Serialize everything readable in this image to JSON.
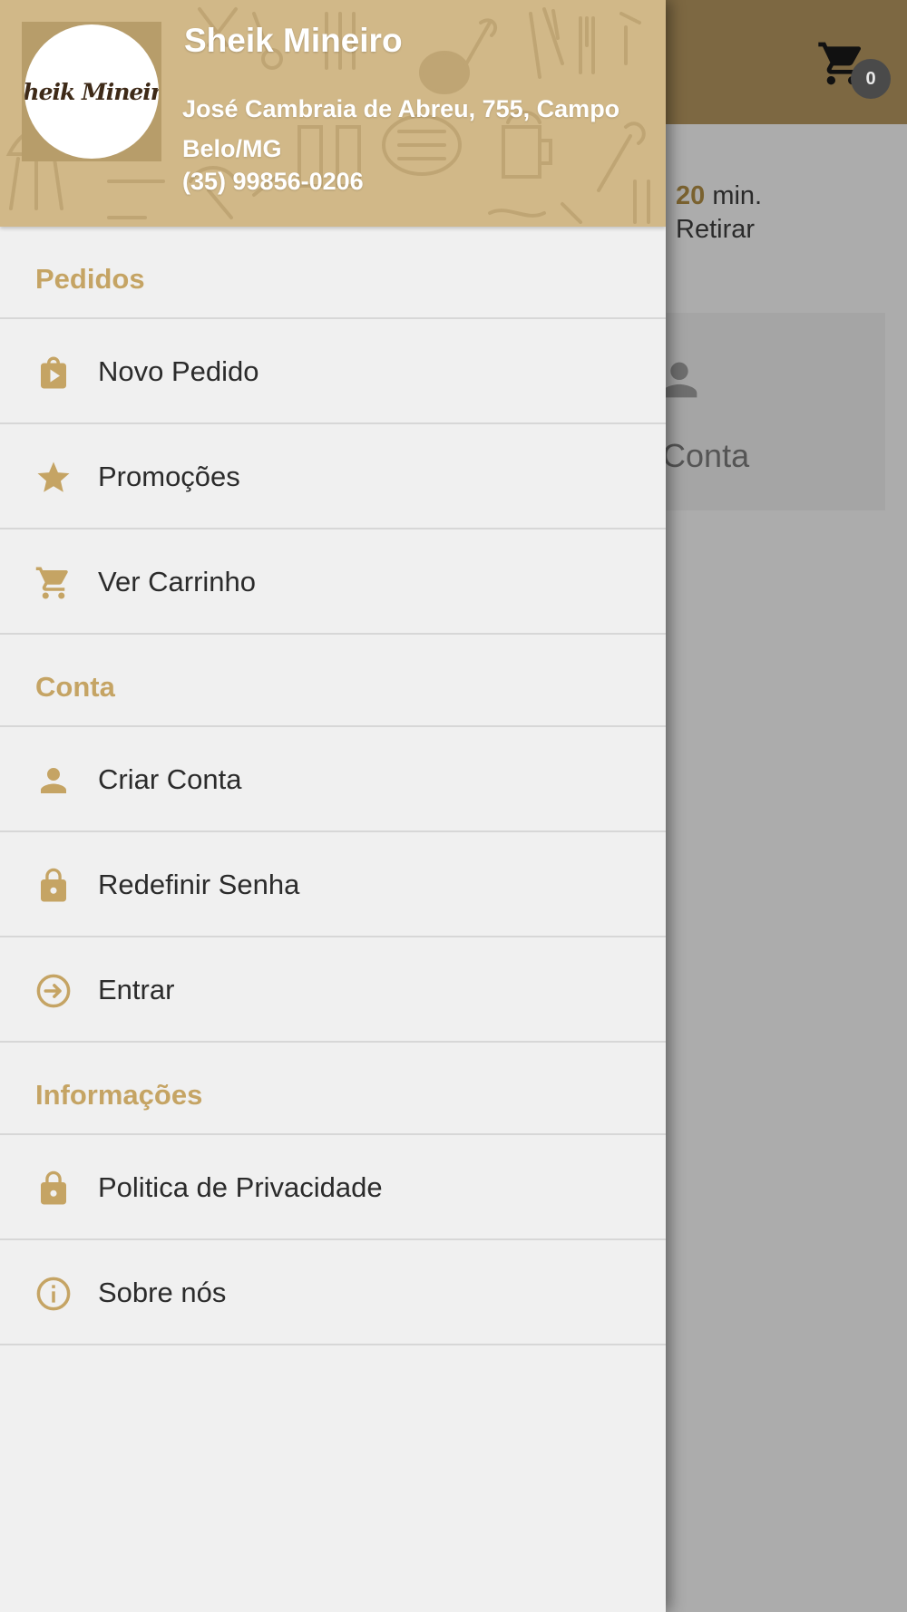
{
  "app_bar": {
    "cart_count": "0",
    "cart_icon": "cart-icon"
  },
  "background": {
    "eta_value": "20",
    "eta_unit": "min.",
    "pickup_label": "Retirar",
    "card_label": "a Conta",
    "card_icon": "person-icon"
  },
  "drawer": {
    "header": {
      "logo_text": "Sheik Mineiro",
      "store_name": "Sheik Mineiro",
      "address": "José Cambraia de Abreu, 755, Campo Belo/MG",
      "phone": "(35) 99856-0206"
    },
    "sections": [
      {
        "title": "Pedidos",
        "items": [
          {
            "label": "Novo Pedido",
            "icon": "shopping-bag-icon"
          },
          {
            "label": "Promoções",
            "icon": "star-icon"
          },
          {
            "label": "Ver Carrinho",
            "icon": "cart-icon"
          }
        ]
      },
      {
        "title": "Conta",
        "items": [
          {
            "label": "Criar Conta",
            "icon": "person-icon"
          },
          {
            "label": "Redefinir Senha",
            "icon": "lock-icon"
          },
          {
            "label": "Entrar",
            "icon": "login-icon"
          }
        ]
      },
      {
        "title": "Informações",
        "items": [
          {
            "label": "Politica de Privacidade",
            "icon": "lock-icon"
          },
          {
            "label": "Sobre nós",
            "icon": "info-icon"
          }
        ]
      }
    ]
  },
  "colors": {
    "accent": "#c5a464",
    "header_bg": "#d1b888",
    "app_bar_bg": "#7d6842",
    "drawer_bg": "#f0f0f0",
    "overlay_bg": "#acacac"
  }
}
